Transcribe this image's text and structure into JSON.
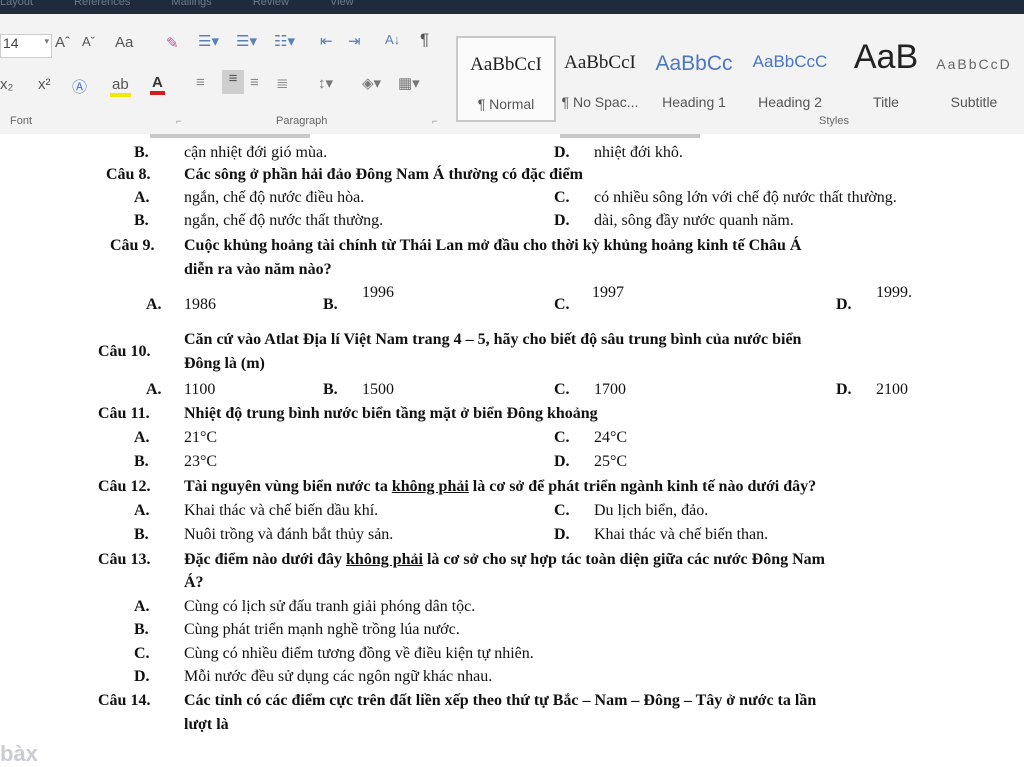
{
  "topbar": {
    "tabs": [
      "Layout",
      "References",
      "Mailings",
      "Review",
      "View"
    ]
  },
  "ribbon": {
    "font_size": "14",
    "grow_font": "Aˆ",
    "shrink_font": "Aˇ",
    "change_case": "Aa",
    "subscript": "x₂",
    "superscript": "x²",
    "font_color_letter": "A",
    "highlight": "ab",
    "sort_icon": "A↓",
    "pilcrow": "¶",
    "group_font": "Font",
    "group_paragraph": "Paragraph",
    "group_styles": "Styles",
    "styles": [
      {
        "sample": "AaBbCcI",
        "name": "¶ Normal"
      },
      {
        "sample": "AaBbCcI",
        "name": "¶ No Spac..."
      },
      {
        "sample": "AaBbCc",
        "name": "Heading 1"
      },
      {
        "sample": "AaBbCcC",
        "name": "Heading 2"
      },
      {
        "sample": "AaB",
        "name": "Title"
      },
      {
        "sample": "AaBbCcD",
        "name": "Subtitle"
      }
    ]
  },
  "document": {
    "prev_options": {
      "b_label": "B.",
      "b": "cận nhiệt đới gió mùa.",
      "d_label": "D.",
      "d": "nhiệt đới khô."
    },
    "q8": {
      "num": "Câu 8.",
      "text": "Các sông ở phần hải đảo Đông Nam Á thường có đặc điểm",
      "a_label": "A.",
      "a": "ngắn, chế độ nước điều hòa.",
      "c_label": "C.",
      "c": "có nhiều sông lớn với chế độ nước thất thường.",
      "b_label": "B.",
      "b": "ngắn, chế độ nước thất thường.",
      "d_label": "D.",
      "d": "dài, sông đầy nước quanh năm."
    },
    "q9": {
      "num": "Câu 9.",
      "text1": "Cuộc khủng hoảng tài chính  từ Thái Lan mở đầu cho thời kỳ khủng hoảng kinh tế Châu Á",
      "text2": "diễn ra vào năm nào?",
      "a_label": "A.",
      "a": "1986",
      "b_label": "B.",
      "b": "1996",
      "c_label": "C.",
      "c": "1997",
      "d_label": "D.",
      "d": "1999."
    },
    "q10": {
      "num": "Câu 10.",
      "text1": "Căn cứ vào Atlat Địa lí Việt Nam trang 4 – 5, hãy cho biết độ sâu trung bình của nước biển",
      "text2": "Đông là (m)",
      "a_label": "A.",
      "a": "1100",
      "b_label": "B.",
      "b": "1500",
      "c_label": "C.",
      "c": "1700",
      "d_label": "D.",
      "d": "2100"
    },
    "q11": {
      "num": "Câu 11.",
      "text": "Nhiệt độ trung bình nước biển tầng mặt ở biển Đông khoảng",
      "a_label": "A.",
      "a": "21°C",
      "c_label": "C.",
      "c": "24°C",
      "b_label": "B.",
      "b": "23°C",
      "d_label": "D.",
      "d": "25°C"
    },
    "q12": {
      "num": "Câu 12.",
      "pre": "Tài nguyên vùng biển nước ta ",
      "neg": "không phải",
      "post": " là cơ sở để phát triển ngành kinh tế nào dưới đây?",
      "a_label": "A.",
      "a": "Khai thác và chế biến dầu khí.",
      "c_label": "C.",
      "c": "Du lịch biển, đảo.",
      "b_label": "B.",
      "b": "Nuôi trồng và đánh bắt thủy sản.",
      "d_label": "D.",
      "d": "Khai thác và chế biến than."
    },
    "q13": {
      "num": "Câu 13.",
      "pre": "Đặc điểm nào dưới đây ",
      "neg": "không phải",
      "post": " là cơ sở cho sự hợp tác toàn diện giữa các nước Đông Nam",
      "text2": "Á?",
      "a_label": "A.",
      "a": "Cùng có lịch sử đấu tranh giải phóng dân tộc.",
      "b_label": "B.",
      "b": "Cùng phát triển mạnh nghề trồng lúa nước.",
      "c_label": "C.",
      "c": "Cùng có nhiều điểm tương đồng về điều kiện tự nhiên.",
      "d_label": "D.",
      "d": "Mỗi nước đều sử dụng các ngôn ngữ khác nhau."
    },
    "q14": {
      "num": "Câu 14.",
      "text1": "Các tỉnh có các điểm cực trên đất liền xếp theo thứ tự Bắc – Nam – Đông – Tây ở nước ta lần",
      "text2": "lượt là"
    }
  },
  "watermark": "bàx"
}
